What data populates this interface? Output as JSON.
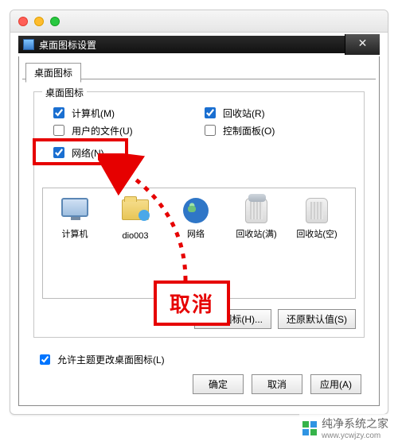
{
  "window": {
    "title": "桌面图标设置"
  },
  "tab": {
    "label": "桌面图标"
  },
  "group": {
    "legend": "桌面图标",
    "checks": {
      "computer": {
        "label": "计算机(M)",
        "checked": true
      },
      "userfiles": {
        "label": "用户的文件(U)",
        "checked": false
      },
      "network": {
        "label": "网络(N)",
        "checked": true
      },
      "recycle": {
        "label": "回收站(R)",
        "checked": true
      },
      "control": {
        "label": "控制面板(O)",
        "checked": false
      }
    }
  },
  "icons": [
    {
      "name": "计算机",
      "kind": "computer"
    },
    {
      "name": "dio003",
      "kind": "userfolder"
    },
    {
      "name": "网络",
      "kind": "network"
    },
    {
      "name": "回收站(满)",
      "kind": "bin-full"
    },
    {
      "name": "回收站(空)",
      "kind": "bin-empty"
    }
  ],
  "buttons": {
    "change_icon": "更改图标(H)...",
    "restore_default": "还原默认值(S)",
    "ok": "确定",
    "cancel": "取消",
    "apply": "应用(A)"
  },
  "theme_check": {
    "label": "允许主题更改桌面图标(L)",
    "checked": true
  },
  "annotation": {
    "cancel_word": "取消"
  },
  "watermark": {
    "text": "纯净系统之家",
    "url": "www.ycwjzy.com"
  }
}
